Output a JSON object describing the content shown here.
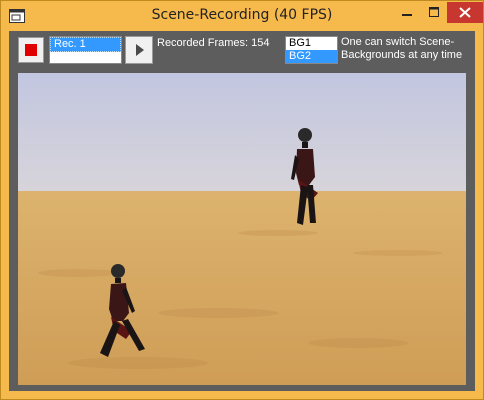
{
  "window": {
    "title": "Scene-Recording (40 FPS)",
    "controls": [
      "minimize-icon",
      "maximize-icon",
      "close-icon"
    ]
  },
  "toolbar": {
    "record_button_icon": "stop-square-icon",
    "recordings": {
      "selected": "Rec. 1"
    },
    "play_button_icon": "play-icon",
    "recorded_frames_label": "Recorded Frames: 154",
    "backgrounds": {
      "items": [
        "BG1",
        "BG2"
      ],
      "selected": "BG2"
    },
    "background_hint": "One can switch Scene-Backgrounds at any time"
  },
  "scene": {
    "sky_color": "#c4c8e0",
    "ground_color": "#d6a761",
    "characters": [
      "walking-figure",
      "walking-figure"
    ]
  },
  "colors": {
    "title_bar": "#f6b94b",
    "close_button": "#c7372f",
    "client_background": "#5d5d5d",
    "selection": "#3399ff",
    "record_red": "#e00000"
  }
}
